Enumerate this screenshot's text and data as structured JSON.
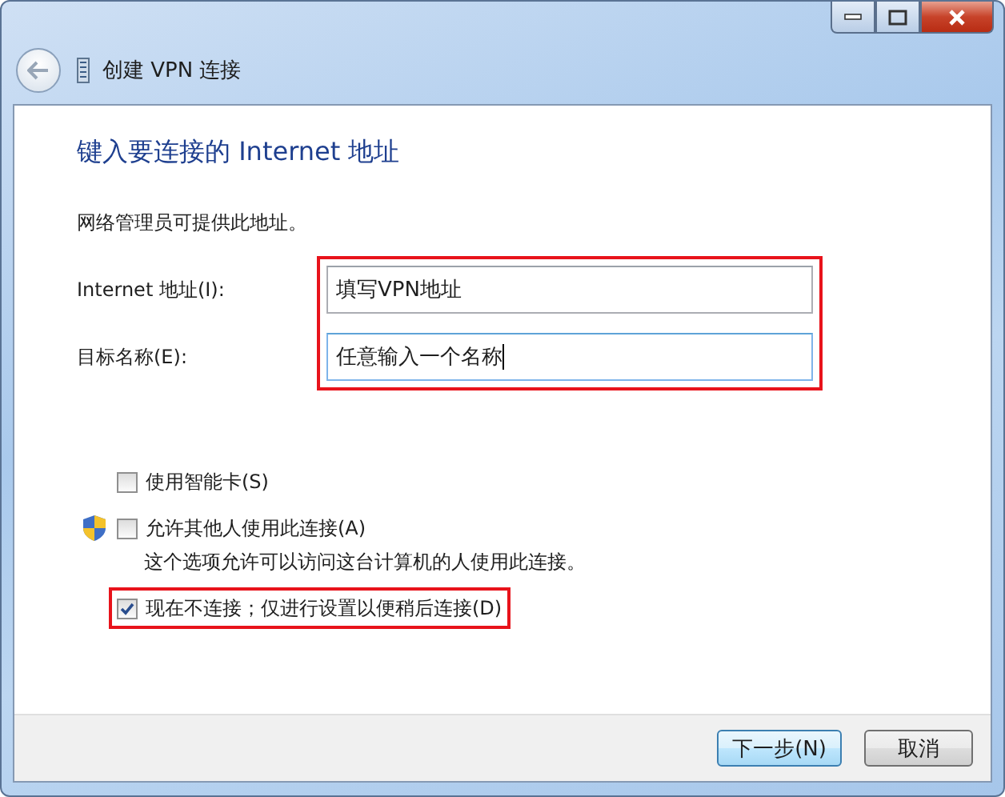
{
  "window": {
    "title": "创建 VPN 连接"
  },
  "heading": "键入要连接的 Internet 地址",
  "intro": "网络管理员可提供此地址。",
  "fields_highlighted": true,
  "fields": [
    {
      "label": "Internet 地址(I):",
      "value": "填写VPN地址",
      "focused": false
    },
    {
      "label": "目标名称(E):",
      "value": "任意输入一个名称",
      "focused": true
    }
  ],
  "options": [
    {
      "label": "使用智能卡(S)",
      "checked": false,
      "shield": false,
      "highlighted": false
    },
    {
      "label": "允许其他人使用此连接(A)",
      "checked": false,
      "shield": true,
      "highlighted": false,
      "description": "这个选项允许可以访问这台计算机的人使用此连接。"
    },
    {
      "label": "现在不连接；仅进行设置以便稍后连接(D)",
      "checked": true,
      "shield": false,
      "highlighted": true
    }
  ],
  "buttons": [
    {
      "label": "下一步(N)",
      "default": true
    },
    {
      "label": "取消",
      "default": false
    }
  ]
}
